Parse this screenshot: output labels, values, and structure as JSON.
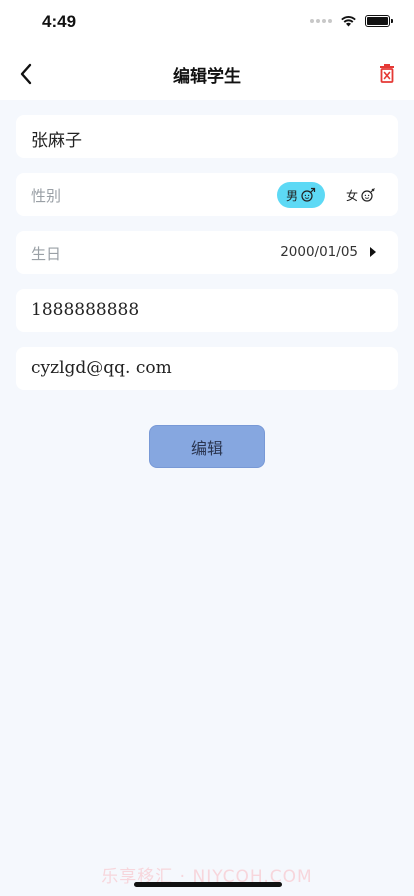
{
  "status": {
    "time": "4:49"
  },
  "nav": {
    "title": "编辑学生",
    "back_icon": "chevron-left-icon",
    "delete_icon": "trash-icon",
    "delete_color": "#e53935"
  },
  "form": {
    "name": {
      "value": "张麻子"
    },
    "gender": {
      "label": "性别",
      "options": [
        "男",
        "女"
      ],
      "selected": "男",
      "selected_color": "#5dd9f5"
    },
    "birthday": {
      "label": "生日",
      "value": "2000/01/05"
    },
    "phone": {
      "value": "1888888888"
    },
    "email": {
      "value": "cyzlgd@qq. com"
    }
  },
  "actions": {
    "save_label": "编辑",
    "save_color": "#86a7e0"
  },
  "watermark": "乐享移汇 · NIYCOH.COM"
}
